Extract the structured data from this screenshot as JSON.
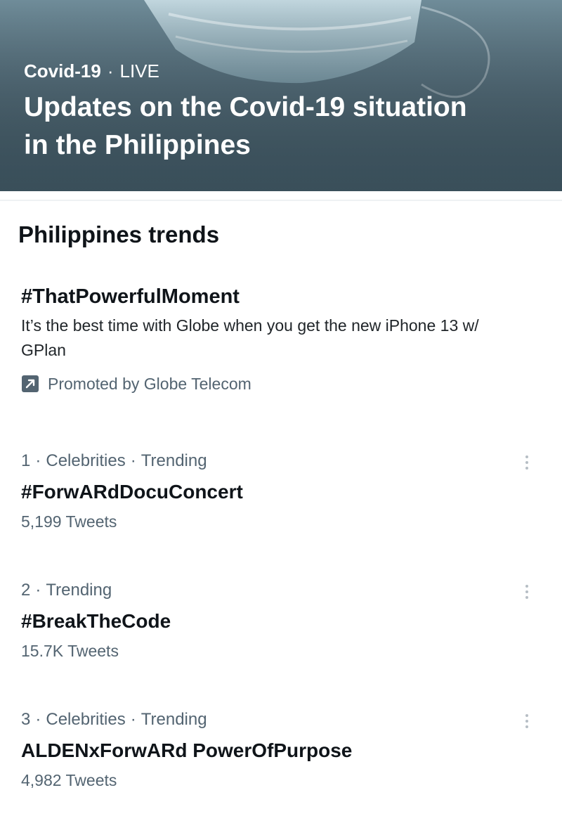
{
  "hero": {
    "category": "Covid-19",
    "status": "LIVE",
    "title": "Updates on the Covid-19 situation in the Philippines",
    "image_icon": "face-mask-icon"
  },
  "section": {
    "title": "Philippines trends"
  },
  "promoted": {
    "hashtag": "#ThatPowerfulMoment",
    "description": "It’s the best time with Globe when you get the new iPhone 13 w/ GPlan",
    "promoted_by": "Promoted by Globe Telecom",
    "icon": "promoted-arrow-icon"
  },
  "trends": [
    {
      "rank": "1",
      "category": "Celebrities",
      "status": "Trending",
      "name": "#ForwARdDocuConcert",
      "count": "5,199 Tweets"
    },
    {
      "rank": "2",
      "category": "",
      "status": "Trending",
      "name": "#BreakTheCode",
      "count": "15.7K Tweets"
    },
    {
      "rank": "3",
      "category": "Celebrities",
      "status": "Trending",
      "name": "ALDENxForwARd PowerOfPurpose",
      "count": "4,982 Tweets"
    }
  ],
  "colors": {
    "text_primary": "#0f1419",
    "text_secondary": "#536471",
    "hero_overlay": "#4b6572"
  }
}
